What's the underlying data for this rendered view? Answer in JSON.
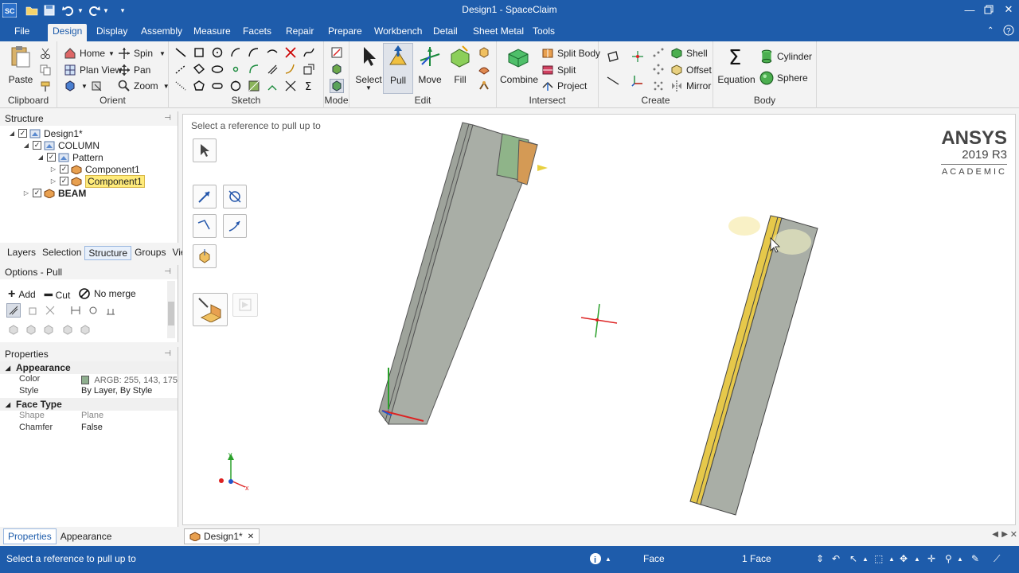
{
  "app": {
    "title": "Design1 - SpaceClaim",
    "logo": "SC"
  },
  "menu": {
    "tabs": [
      "File",
      "Design",
      "Display",
      "Assembly",
      "Measure",
      "Facets",
      "Repair",
      "Prepare",
      "Workbench",
      "Detail",
      "Sheet Metal",
      "Tools"
    ],
    "active": "Design"
  },
  "ribbon": {
    "clipboard": {
      "label": "Clipboard",
      "paste": "Paste"
    },
    "orient": {
      "label": "Orient",
      "home": "Home",
      "spin": "Spin",
      "plan_view": "Plan View",
      "pan": "Pan",
      "zoom": "Zoom"
    },
    "sketch": {
      "label": "Sketch"
    },
    "mode": {
      "label": "Mode"
    },
    "edit": {
      "label": "Edit",
      "select": "Select",
      "pull": "Pull",
      "move": "Move",
      "fill": "Fill"
    },
    "intersect": {
      "label": "Intersect",
      "combine": "Combine",
      "split_body": "Split Body",
      "split": "Split",
      "project": "Project"
    },
    "create": {
      "label": "Create",
      "shell": "Shell",
      "offset": "Offset",
      "mirror": "Mirror"
    },
    "body": {
      "label": "Body",
      "equation": "Equation",
      "cylinder": "Cylinder",
      "sphere": "Sphere"
    }
  },
  "structure": {
    "title": "Structure",
    "items": [
      {
        "label": "Design1*"
      },
      {
        "label": "COLUMN"
      },
      {
        "label": "Pattern"
      },
      {
        "label": "Component1"
      },
      {
        "label": "Component1"
      },
      {
        "label": "BEAM"
      }
    ]
  },
  "panel_tabs": [
    "Layers",
    "Selection",
    "Structure",
    "Groups",
    "Views"
  ],
  "options": {
    "title": "Options - Pull",
    "add": "Add",
    "cut": "Cut",
    "no_merge": "No merge"
  },
  "properties": {
    "title": "Properties",
    "appearance_header": "Appearance",
    "color_key": "Color",
    "color_value": "ARGB: 255, 143, 175",
    "style_key": "Style",
    "style_value": "By Layer, By Style",
    "face_type_header": "Face Type",
    "shape_key": "Shape",
    "shape_value": "Plane",
    "chamfer_key": "Chamfer",
    "chamfer_value": "False"
  },
  "bottom_tabs": [
    "Properties",
    "Appearance"
  ],
  "viewport": {
    "hint": "Select a reference to pull up to",
    "brand_name": "ANSYS",
    "brand_version": "2019 R3",
    "brand_edition": "ACADEMIC"
  },
  "doc_tab": "Design1*",
  "status": {
    "message": "Select a reference to pull up to",
    "selection_filter": "Face",
    "selection_count": "1 Face"
  },
  "colors": {
    "titlebar": "#1e5cab",
    "highlight_yellow": "#ffeb7a",
    "body_gray": "#a9aea6",
    "face_yellow": "#e6c84a"
  }
}
